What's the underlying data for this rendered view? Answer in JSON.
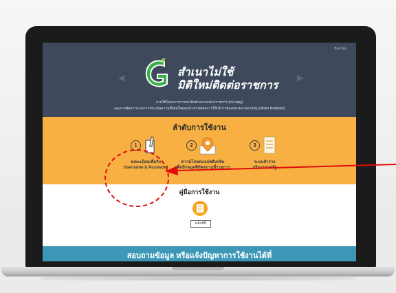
{
  "site": {
    "top_nav": "กิจกรรม",
    "tagline_line1": "สำเนาไม่ใช้",
    "tagline_line2": "มิติใหม่ติดต่อราชการ",
    "sub_line1": "ภายใต้โครงการการยกเลิกสำเนาเอกสารราชการ (no copy)",
    "sub_line2": "และการพัฒนาระบบการประเมินความพึงพอใจของประชาชนต่อการให้บริการของหน่วยงานภาครัฐ (citizen feedback)"
  },
  "steps": {
    "title": "ลำดับการใช้งาน",
    "items": [
      {
        "number": "1",
        "line1": "ลงทะเบียนเพื่อรับ",
        "line2": "Username & Password"
      },
      {
        "number": "2",
        "line1": "ดาวน์โหลดแอปพลิเคชัน",
        "line2": "เพื่อปักหมุดพิกัดสถานที่ราชการ"
      },
      {
        "number": "3",
        "line1": "ระบบสำรวจ",
        "line2": "บริการภาครัฐ"
      }
    ]
  },
  "manual": {
    "title": "คู่มือการใช้งาน",
    "button": "คลิกที่นี่"
  },
  "contact_text": "สอบถามข้อมูล หรือแจ้งปัญหาการใช้งานได้ที่",
  "colors": {
    "hero": "#3e4a5c",
    "orange": "#f8b043",
    "bottom_bar": "#3c98b6",
    "annotation": "#e10b0b",
    "logo_green": "#38b04a"
  },
  "icons": [
    "logo-g-icon",
    "document-pen-icon",
    "map-pin-icon",
    "checklist-icon",
    "manual-document-icon",
    "red-arrow-icon"
  ]
}
